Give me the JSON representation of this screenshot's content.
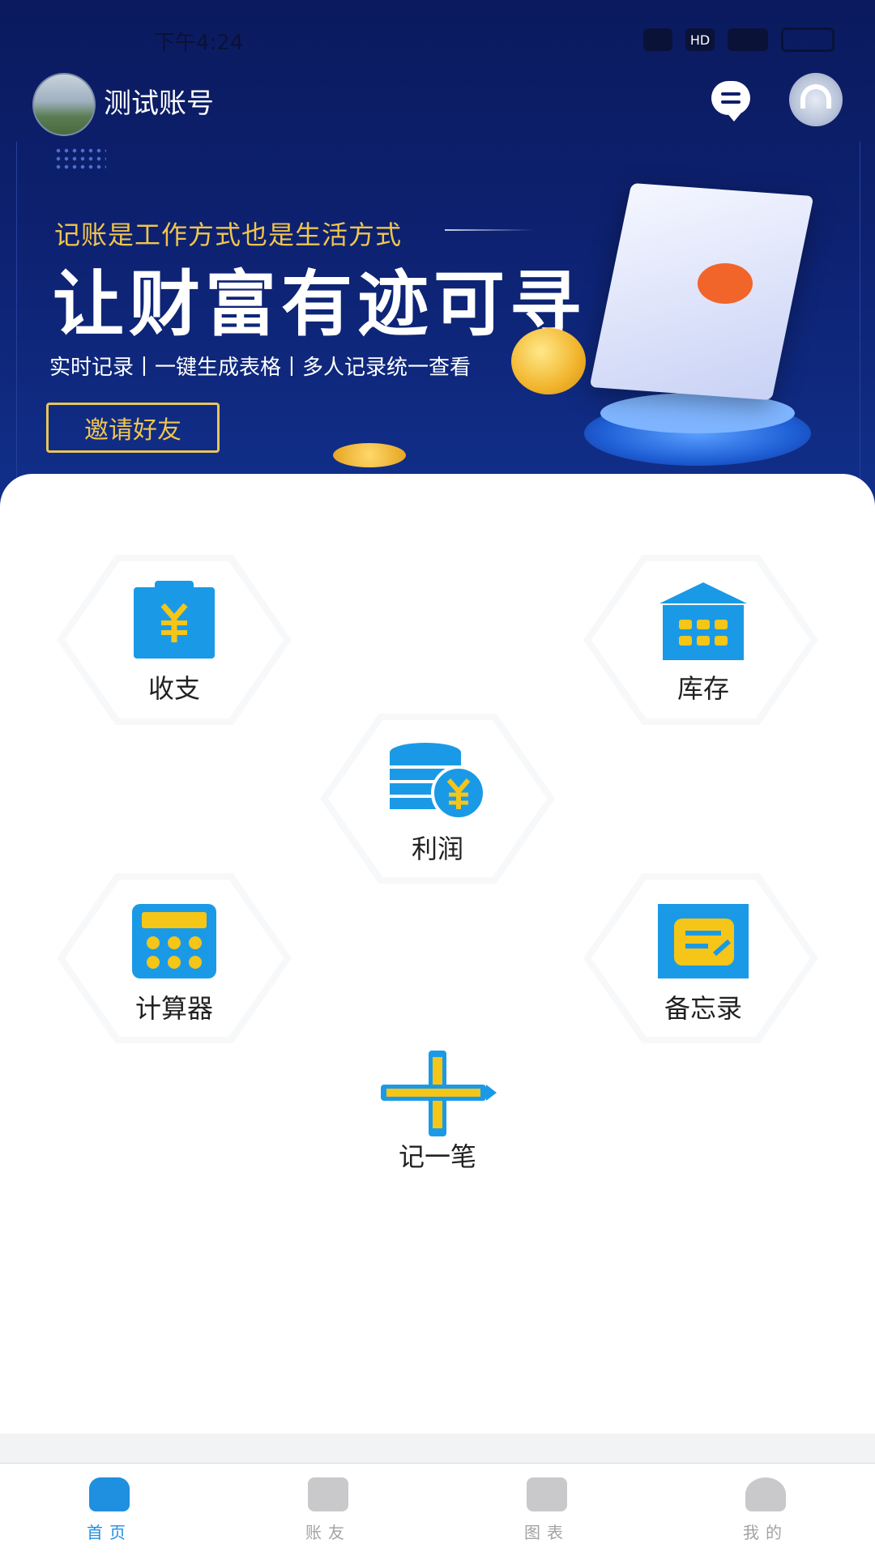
{
  "status_bar": {
    "time": "下午4:24",
    "hd": "HD"
  },
  "header": {
    "account_name": "测试账号"
  },
  "banner": {
    "slogan_top": "记账是工作方式也是生活方式",
    "slogan_main": "让财富有迹可寻",
    "slogan_sub": "实时记录丨一键生成表格丨多人记录统一查看",
    "invite_label": "邀请好友"
  },
  "features": {
    "income_expense": "收支",
    "inventory": "库存",
    "profit": "利润",
    "calculator": "计算器",
    "memo": "备忘录",
    "record": "记一笔"
  },
  "colors": {
    "accent": "#1f8fe0",
    "icon_blue": "#1a9ae6",
    "icon_yellow": "#f5c518",
    "banner_bg": "#0d2170",
    "gold": "#f0c54d"
  },
  "nav": {
    "items": [
      {
        "label": "首页",
        "icon": "home-icon",
        "active": true
      },
      {
        "label": "账友",
        "icon": "list-icon",
        "active": false
      },
      {
        "label": "图表",
        "icon": "chart-icon",
        "active": false
      },
      {
        "label": "我的",
        "icon": "user-icon",
        "active": false
      }
    ]
  }
}
